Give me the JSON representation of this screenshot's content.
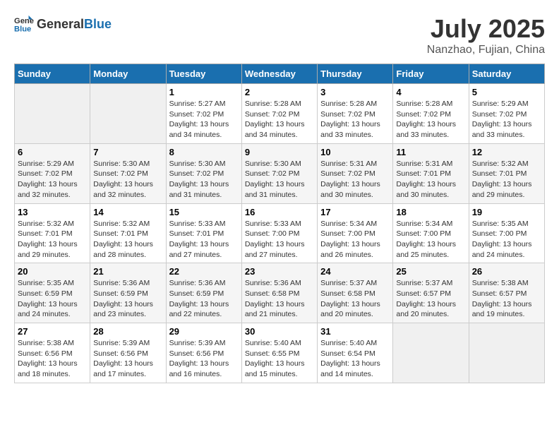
{
  "header": {
    "logo_general": "General",
    "logo_blue": "Blue",
    "title": "July 2025",
    "subtitle": "Nanzhao, Fujian, China"
  },
  "days_of_week": [
    "Sunday",
    "Monday",
    "Tuesday",
    "Wednesday",
    "Thursday",
    "Friday",
    "Saturday"
  ],
  "weeks": [
    [
      {
        "day": "",
        "info": ""
      },
      {
        "day": "",
        "info": ""
      },
      {
        "day": "1",
        "info": "Sunrise: 5:27 AM\nSunset: 7:02 PM\nDaylight: 13 hours and 34 minutes."
      },
      {
        "day": "2",
        "info": "Sunrise: 5:28 AM\nSunset: 7:02 PM\nDaylight: 13 hours and 34 minutes."
      },
      {
        "day": "3",
        "info": "Sunrise: 5:28 AM\nSunset: 7:02 PM\nDaylight: 13 hours and 33 minutes."
      },
      {
        "day": "4",
        "info": "Sunrise: 5:28 AM\nSunset: 7:02 PM\nDaylight: 13 hours and 33 minutes."
      },
      {
        "day": "5",
        "info": "Sunrise: 5:29 AM\nSunset: 7:02 PM\nDaylight: 13 hours and 33 minutes."
      }
    ],
    [
      {
        "day": "6",
        "info": "Sunrise: 5:29 AM\nSunset: 7:02 PM\nDaylight: 13 hours and 32 minutes."
      },
      {
        "day": "7",
        "info": "Sunrise: 5:30 AM\nSunset: 7:02 PM\nDaylight: 13 hours and 32 minutes."
      },
      {
        "day": "8",
        "info": "Sunrise: 5:30 AM\nSunset: 7:02 PM\nDaylight: 13 hours and 31 minutes."
      },
      {
        "day": "9",
        "info": "Sunrise: 5:30 AM\nSunset: 7:02 PM\nDaylight: 13 hours and 31 minutes."
      },
      {
        "day": "10",
        "info": "Sunrise: 5:31 AM\nSunset: 7:02 PM\nDaylight: 13 hours and 30 minutes."
      },
      {
        "day": "11",
        "info": "Sunrise: 5:31 AM\nSunset: 7:01 PM\nDaylight: 13 hours and 30 minutes."
      },
      {
        "day": "12",
        "info": "Sunrise: 5:32 AM\nSunset: 7:01 PM\nDaylight: 13 hours and 29 minutes."
      }
    ],
    [
      {
        "day": "13",
        "info": "Sunrise: 5:32 AM\nSunset: 7:01 PM\nDaylight: 13 hours and 29 minutes."
      },
      {
        "day": "14",
        "info": "Sunrise: 5:32 AM\nSunset: 7:01 PM\nDaylight: 13 hours and 28 minutes."
      },
      {
        "day": "15",
        "info": "Sunrise: 5:33 AM\nSunset: 7:01 PM\nDaylight: 13 hours and 27 minutes."
      },
      {
        "day": "16",
        "info": "Sunrise: 5:33 AM\nSunset: 7:00 PM\nDaylight: 13 hours and 27 minutes."
      },
      {
        "day": "17",
        "info": "Sunrise: 5:34 AM\nSunset: 7:00 PM\nDaylight: 13 hours and 26 minutes."
      },
      {
        "day": "18",
        "info": "Sunrise: 5:34 AM\nSunset: 7:00 PM\nDaylight: 13 hours and 25 minutes."
      },
      {
        "day": "19",
        "info": "Sunrise: 5:35 AM\nSunset: 7:00 PM\nDaylight: 13 hours and 24 minutes."
      }
    ],
    [
      {
        "day": "20",
        "info": "Sunrise: 5:35 AM\nSunset: 6:59 PM\nDaylight: 13 hours and 24 minutes."
      },
      {
        "day": "21",
        "info": "Sunrise: 5:36 AM\nSunset: 6:59 PM\nDaylight: 13 hours and 23 minutes."
      },
      {
        "day": "22",
        "info": "Sunrise: 5:36 AM\nSunset: 6:59 PM\nDaylight: 13 hours and 22 minutes."
      },
      {
        "day": "23",
        "info": "Sunrise: 5:36 AM\nSunset: 6:58 PM\nDaylight: 13 hours and 21 minutes."
      },
      {
        "day": "24",
        "info": "Sunrise: 5:37 AM\nSunset: 6:58 PM\nDaylight: 13 hours and 20 minutes."
      },
      {
        "day": "25",
        "info": "Sunrise: 5:37 AM\nSunset: 6:57 PM\nDaylight: 13 hours and 20 minutes."
      },
      {
        "day": "26",
        "info": "Sunrise: 5:38 AM\nSunset: 6:57 PM\nDaylight: 13 hours and 19 minutes."
      }
    ],
    [
      {
        "day": "27",
        "info": "Sunrise: 5:38 AM\nSunset: 6:56 PM\nDaylight: 13 hours and 18 minutes."
      },
      {
        "day": "28",
        "info": "Sunrise: 5:39 AM\nSunset: 6:56 PM\nDaylight: 13 hours and 17 minutes."
      },
      {
        "day": "29",
        "info": "Sunrise: 5:39 AM\nSunset: 6:56 PM\nDaylight: 13 hours and 16 minutes."
      },
      {
        "day": "30",
        "info": "Sunrise: 5:40 AM\nSunset: 6:55 PM\nDaylight: 13 hours and 15 minutes."
      },
      {
        "day": "31",
        "info": "Sunrise: 5:40 AM\nSunset: 6:54 PM\nDaylight: 13 hours and 14 minutes."
      },
      {
        "day": "",
        "info": ""
      },
      {
        "day": "",
        "info": ""
      }
    ]
  ]
}
